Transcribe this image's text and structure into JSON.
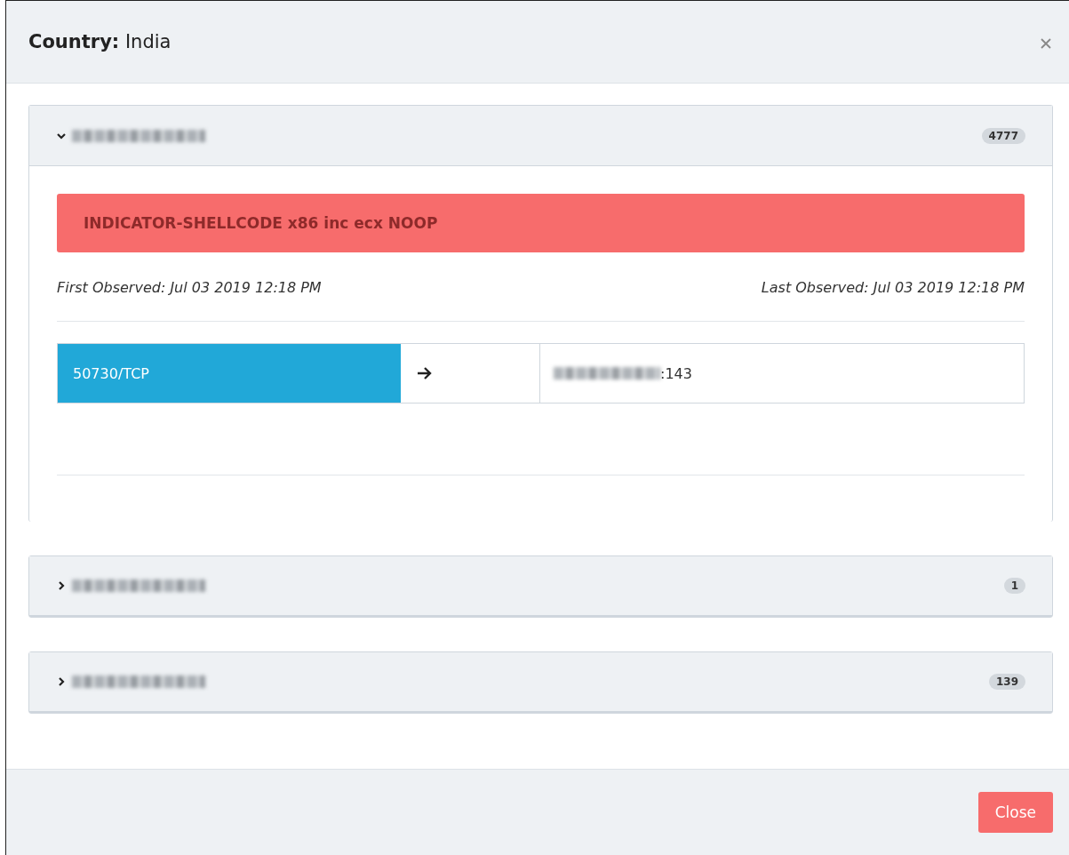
{
  "modal": {
    "title_label": "Country:",
    "title_value": "India"
  },
  "panels": [
    {
      "expanded": true,
      "count": "4777",
      "alert": "INDICATOR-SHELLCODE x86 inc ecx NOOP",
      "first_observed": "First Observed: Jul 03 2019 12:18 PM",
      "last_observed": "Last Observed: Jul 03 2019 12:18 PM",
      "source_port": "50730/TCP",
      "destination_port": ":143"
    },
    {
      "expanded": false,
      "count": "1"
    },
    {
      "expanded": false,
      "count": "139"
    }
  ],
  "footer": {
    "close_button": "Close"
  }
}
